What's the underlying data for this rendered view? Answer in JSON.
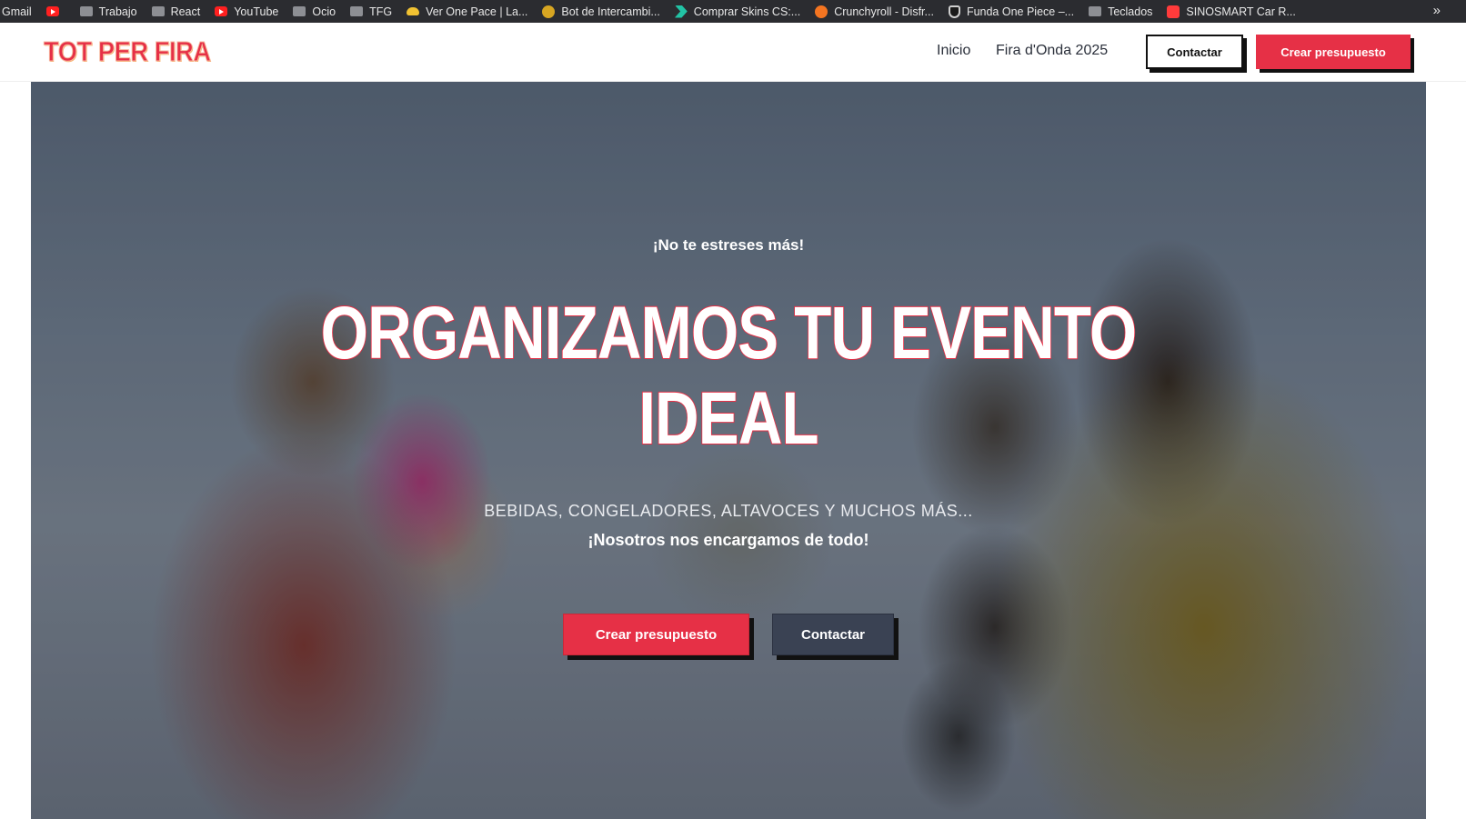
{
  "bookmarks": [
    {
      "label": "Gmail",
      "icon": "gmail-icon"
    },
    {
      "label": "",
      "icon": "youtube-icon"
    },
    {
      "label": "Trabajo",
      "icon": "folder-icon"
    },
    {
      "label": "React",
      "icon": "folder-icon"
    },
    {
      "label": "YouTube",
      "icon": "youtube-icon"
    },
    {
      "label": "Ocio",
      "icon": "folder-icon"
    },
    {
      "label": "TFG",
      "icon": "folder-icon"
    },
    {
      "label": "Ver One Pace | La...",
      "icon": "straw-hat-icon"
    },
    {
      "label": "Bot de Intercambi...",
      "icon": "coin-icon"
    },
    {
      "label": "Comprar Skins CS:...",
      "icon": "chevron-icon"
    },
    {
      "label": "Crunchyroll - Disfr...",
      "icon": "crunchyroll-icon"
    },
    {
      "label": "Funda One Piece –...",
      "icon": "shield-icon"
    },
    {
      "label": "Teclados",
      "icon": "folder-icon"
    },
    {
      "label": "SINOSMART Car R...",
      "icon": "sinosmart-icon"
    }
  ],
  "bookmarks_more": "»",
  "header": {
    "logo": "TOT PER FIRA",
    "nav": [
      "Inicio",
      "Fira d'Onda 2025"
    ],
    "contact_button": "Contactar",
    "quote_button": "Crear presupuesto"
  },
  "hero": {
    "kicker": "¡No te estreses más!",
    "headline_line1": "ORGANIZAMOS TU EVENTO",
    "headline_line2": "IDEAL",
    "subline": "BEBIDAS, CONGELADORES, ALTAVOCES Y MUCHOS MÁS...",
    "subline_bold": "¡Nosotros nos encargamos de todo!",
    "cta_primary": "Crear presupuesto",
    "cta_secondary": "Contactar"
  },
  "colors": {
    "brand_red": "#e63046",
    "dark_button": "#3a4253",
    "bookmarks_bar": "#2b2c30"
  }
}
